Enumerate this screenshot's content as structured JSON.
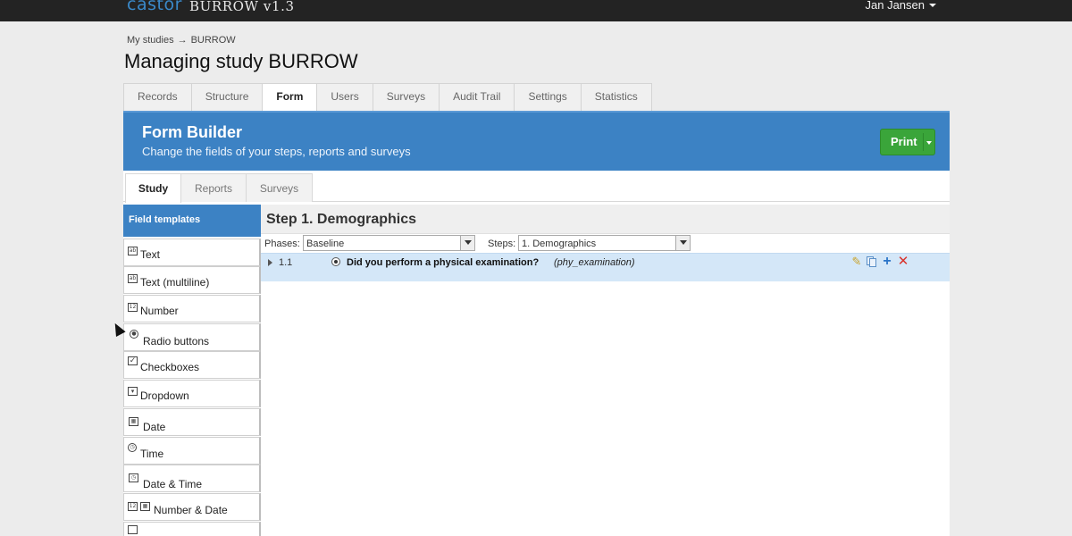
{
  "topbar": {
    "brand": "castor",
    "app_name": "BURROW v1.3",
    "user_name": "Jan Jansen"
  },
  "breadcrumb": {
    "parent": "My studies",
    "arrow": "→",
    "current": "BURROW"
  },
  "page_title": "Managing study BURROW",
  "main_tabs": [
    {
      "label": "Records"
    },
    {
      "label": "Structure"
    },
    {
      "label": "Form",
      "active": true
    },
    {
      "label": "Users"
    },
    {
      "label": "Surveys"
    },
    {
      "label": "Audit Trail"
    },
    {
      "label": "Settings"
    },
    {
      "label": "Statistics"
    }
  ],
  "form_builder": {
    "title": "Form Builder",
    "subtitle": "Change the fields of your steps, reports and surveys",
    "print_label": "Print"
  },
  "sub_tabs": [
    {
      "label": "Study",
      "active": true
    },
    {
      "label": "Reports"
    },
    {
      "label": "Surveys"
    }
  ],
  "sidebar": {
    "header": "Field templates",
    "items": [
      {
        "label": "Text",
        "icon": "text-field-icon"
      },
      {
        "label": "Text (multiline)",
        "icon": "multiline-text-icon"
      },
      {
        "label": "Number",
        "icon": "number-field-icon"
      },
      {
        "label": "Radio buttons",
        "icon": "radio-icon"
      },
      {
        "label": "Checkboxes",
        "icon": "checkbox-icon"
      },
      {
        "label": "Dropdown",
        "icon": "dropdown-icon"
      },
      {
        "label": "Date",
        "icon": "calendar-icon"
      },
      {
        "label": "Time",
        "icon": "clock-icon"
      },
      {
        "label": "Date & Time",
        "icon": "date-time-icon"
      },
      {
        "label": "Number & Date",
        "icon": "number-date-icon"
      }
    ]
  },
  "step": {
    "title": "Step 1. Demographics",
    "phases_label": "Phases:",
    "phases_value": "Baseline",
    "steps_label": "Steps:",
    "steps_value": "1. Demographics"
  },
  "fields": [
    {
      "number": "1.1",
      "type_icon": "radio-icon",
      "question": "Did you perform a physical examination?",
      "variable": "(phy_examination)"
    }
  ],
  "colors": {
    "accent_blue": "#3c82c4",
    "print_green": "#3aa53a",
    "selected_row": "#d4e7f8",
    "topbar": "#232323"
  }
}
